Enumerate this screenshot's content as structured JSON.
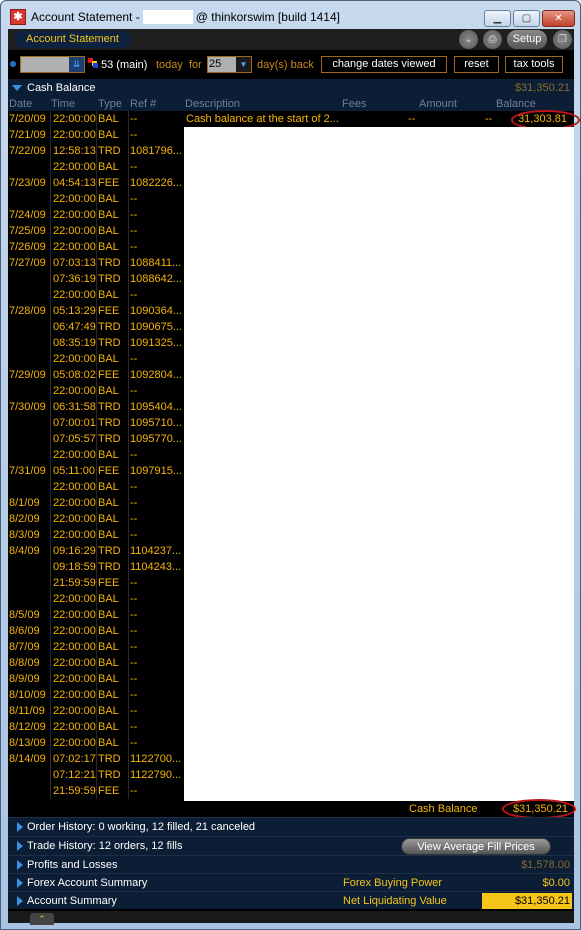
{
  "window": {
    "title_prefix": "Account Statement -",
    "title_suffix": "@ thinkorswim [build 1414]",
    "minimize_glyph": "▁",
    "maximize_glyph": "▢",
    "close_glyph": "✕"
  },
  "tabbar": {
    "active_tab": "Account Statement",
    "setup_label": "Setup",
    "collapse_glyph": "⌄",
    "print_glyph": "⎙",
    "detach_glyph": "❐"
  },
  "filters": {
    "account_value": "",
    "account_label": "53 (main)",
    "today_label": "today",
    "for_label": "for",
    "days_value": "25",
    "days_back_label": "day(s) back",
    "change_dates_label": "change dates viewed",
    "reset_label": "reset",
    "tax_tools_label": "tax tools"
  },
  "cash_balance": {
    "title": "Cash Balance",
    "header_amount": "$31,350.21",
    "columns": [
      "Date",
      "Time",
      "Type",
      "Ref #",
      "Description",
      "Fees",
      "Amount",
      "Balance"
    ],
    "first_row": {
      "date": "7/20/09",
      "time": "22:00:00",
      "type": "BAL",
      "ref": "--",
      "description": "Cash balance at the start of 2...",
      "fees": "--",
      "amount": "--",
      "balance": "31,303.81"
    },
    "rows": [
      {
        "date": "7/21/09",
        "time": "22:00:00",
        "type": "BAL",
        "ref": "--"
      },
      {
        "date": "7/22/09",
        "time": "12:58:13",
        "type": "TRD",
        "ref": "1081796..."
      },
      {
        "date": "",
        "time": "22:00:00",
        "type": "BAL",
        "ref": "--"
      },
      {
        "date": "7/23/09",
        "time": "04:54:13",
        "type": "FEE",
        "ref": "1082226..."
      },
      {
        "date": "",
        "time": "22:00:00",
        "type": "BAL",
        "ref": "--"
      },
      {
        "date": "7/24/09",
        "time": "22:00:00",
        "type": "BAL",
        "ref": "--"
      },
      {
        "date": "7/25/09",
        "time": "22:00:00",
        "type": "BAL",
        "ref": "--"
      },
      {
        "date": "7/26/09",
        "time": "22:00:00",
        "type": "BAL",
        "ref": "--"
      },
      {
        "date": "7/27/09",
        "time": "07:03:13",
        "type": "TRD",
        "ref": "1088411..."
      },
      {
        "date": "",
        "time": "07:36:19",
        "type": "TRD",
        "ref": "1088642..."
      },
      {
        "date": "",
        "time": "22:00:00",
        "type": "BAL",
        "ref": "--"
      },
      {
        "date": "7/28/09",
        "time": "05:13:29",
        "type": "FEE",
        "ref": "1090364..."
      },
      {
        "date": "",
        "time": "06:47:49",
        "type": "TRD",
        "ref": "1090675..."
      },
      {
        "date": "",
        "time": "08:35:19",
        "type": "TRD",
        "ref": "1091325..."
      },
      {
        "date": "",
        "time": "22:00:00",
        "type": "BAL",
        "ref": "--"
      },
      {
        "date": "7/29/09",
        "time": "05:08:02",
        "type": "FEE",
        "ref": "1092804..."
      },
      {
        "date": "",
        "time": "22:00:00",
        "type": "BAL",
        "ref": "--"
      },
      {
        "date": "7/30/09",
        "time": "06:31:58",
        "type": "TRD",
        "ref": "1095404..."
      },
      {
        "date": "",
        "time": "07:00:01",
        "type": "TRD",
        "ref": "1095710..."
      },
      {
        "date": "",
        "time": "07:05:57",
        "type": "TRD",
        "ref": "1095770..."
      },
      {
        "date": "",
        "time": "22:00:00",
        "type": "BAL",
        "ref": "--"
      },
      {
        "date": "7/31/09",
        "time": "05:11:00",
        "type": "FEE",
        "ref": "1097915..."
      },
      {
        "date": "",
        "time": "22:00:00",
        "type": "BAL",
        "ref": "--"
      },
      {
        "date": "8/1/09",
        "time": "22:00:00",
        "type": "BAL",
        "ref": "--"
      },
      {
        "date": "8/2/09",
        "time": "22:00:00",
        "type": "BAL",
        "ref": "--"
      },
      {
        "date": "8/3/09",
        "time": "22:00:00",
        "type": "BAL",
        "ref": "--"
      },
      {
        "date": "8/4/09",
        "time": "09:16:29",
        "type": "TRD",
        "ref": "1104237..."
      },
      {
        "date": "",
        "time": "09:18:59",
        "type": "TRD",
        "ref": "1104243..."
      },
      {
        "date": "",
        "time": "21:59:59",
        "type": "FEE",
        "ref": "--"
      },
      {
        "date": "",
        "time": "22:00:00",
        "type": "BAL",
        "ref": "--"
      },
      {
        "date": "8/5/09",
        "time": "22:00:00",
        "type": "BAL",
        "ref": "--"
      },
      {
        "date": "8/6/09",
        "time": "22:00:00",
        "type": "BAL",
        "ref": "--"
      },
      {
        "date": "8/7/09",
        "time": "22:00:00",
        "type": "BAL",
        "ref": "--"
      },
      {
        "date": "8/8/09",
        "time": "22:00:00",
        "type": "BAL",
        "ref": "--"
      },
      {
        "date": "8/9/09",
        "time": "22:00:00",
        "type": "BAL",
        "ref": "--"
      },
      {
        "date": "8/10/09",
        "time": "22:00:00",
        "type": "BAL",
        "ref": "--"
      },
      {
        "date": "8/11/09",
        "time": "22:00:00",
        "type": "BAL",
        "ref": "--"
      },
      {
        "date": "8/12/09",
        "time": "22:00:00",
        "type": "BAL",
        "ref": "--"
      },
      {
        "date": "8/13/09",
        "time": "22:00:00",
        "type": "BAL",
        "ref": "--"
      },
      {
        "date": "8/14/09",
        "time": "07:02:17",
        "type": "TRD",
        "ref": "1122700..."
      },
      {
        "date": "",
        "time": "07:12:21",
        "type": "TRD",
        "ref": "1122790..."
      },
      {
        "date": "",
        "time": "21:59:59",
        "type": "FEE",
        "ref": "--"
      }
    ],
    "total_label": "Cash Balance",
    "total_value": "$31,350.21"
  },
  "summaries": {
    "order_history": "Order History: 0 working, 12 filled, 21 canceled",
    "trade_history": "Trade History: 12 orders, 12 fills",
    "view_avg_fill_label": "View Average Fill Prices",
    "profits_losses": "Profits and Losses",
    "profits_losses_value": "$1,578.00",
    "forex_summary": "Forex Account Summary",
    "forex_bp_label": "Forex Buying Power",
    "forex_bp_value": "$0.00",
    "account_summary": "Account Summary",
    "net_liq_label": "Net Liquidating Value",
    "net_liq_value": "$31,350.21"
  },
  "bottom": {
    "expand_glyph": "⌃"
  },
  "colors": {
    "accent_yellow": "#f5b40a",
    "panel_navy": "#0c1e36",
    "highlight": "#f5c518",
    "annotation_red": "#c0141a"
  }
}
